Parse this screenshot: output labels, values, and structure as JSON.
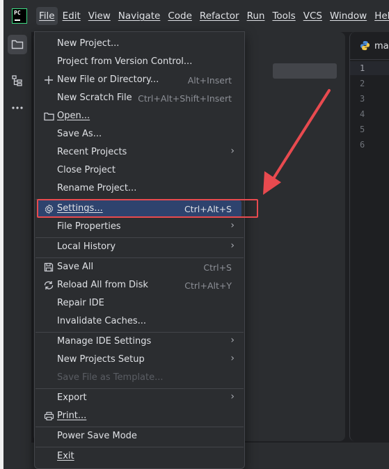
{
  "app": {
    "logo_text": "PC"
  },
  "menubar": {
    "items": [
      {
        "label": "File",
        "active": true
      },
      {
        "label": "Edit"
      },
      {
        "label": "View"
      },
      {
        "label": "Navigate"
      },
      {
        "label": "Code"
      },
      {
        "label": "Refactor"
      },
      {
        "label": "Run"
      },
      {
        "label": "Tools"
      },
      {
        "label": "VCS"
      },
      {
        "label": "Window"
      },
      {
        "label": "Help"
      }
    ]
  },
  "editor": {
    "tab_label": "mai",
    "line_numbers": [
      "1",
      "2",
      "3",
      "4",
      "5",
      "6"
    ]
  },
  "file_menu": {
    "items": [
      {
        "label": "New Project..."
      },
      {
        "label": "Project from Version Control..."
      },
      {
        "label": "New File or Directory...",
        "shortcut": "Alt+Insert",
        "icon": "plus-icon"
      },
      {
        "label": "New Scratch File",
        "shortcut": "Ctrl+Alt+Shift+Insert"
      },
      {
        "label": "Open...",
        "icon": "folder-icon"
      },
      {
        "label": "Save As..."
      },
      {
        "label": "Recent Projects",
        "submenu": true
      },
      {
        "label": "Close Project"
      },
      {
        "label": "Rename Project..."
      },
      {
        "label": "Settings...",
        "shortcut": "Ctrl+Alt+S",
        "icon": "gear-icon",
        "highlighted": true
      },
      {
        "label": "File Properties",
        "submenu": true
      },
      {
        "label": "Local History",
        "submenu": true
      },
      {
        "label": "Save All",
        "shortcut": "Ctrl+S",
        "icon": "save-icon"
      },
      {
        "label": "Reload All from Disk",
        "shortcut": "Ctrl+Alt+Y",
        "icon": "reload-icon"
      },
      {
        "label": "Repair IDE"
      },
      {
        "label": "Invalidate Caches..."
      },
      {
        "label": "Manage IDE Settings",
        "submenu": true
      },
      {
        "label": "New Projects Setup",
        "submenu": true
      },
      {
        "label": "Save File as Template...",
        "disabled": true
      },
      {
        "label": "Export",
        "submenu": true
      },
      {
        "label": "Print...",
        "icon": "print-icon"
      },
      {
        "label": "Power Save Mode"
      },
      {
        "label": "Exit"
      }
    ],
    "submenu_glyph": "›"
  },
  "colors": {
    "highlight": "#2e436e",
    "annotation": "#e84a4f"
  }
}
